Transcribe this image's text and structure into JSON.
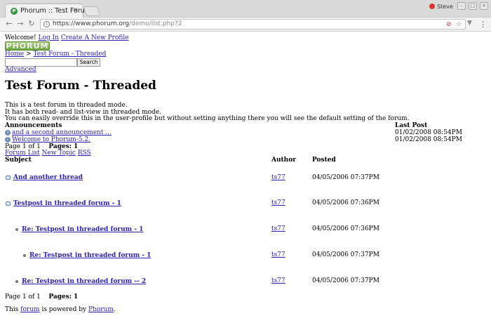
{
  "browser": {
    "tab_title": "Phorum :: Test Foru",
    "tab_close": "×",
    "user_name": "Steve",
    "window_buttons": [
      "–",
      "□",
      "×"
    ],
    "url_domain": "https://www.phorum.org",
    "url_path": "/demo/list.php?2",
    "back": "←",
    "forward": "→",
    "reload": "↻",
    "menu": "⋮",
    "star": "☆"
  },
  "header": {
    "welcome": "Welcome!",
    "login": "Log In",
    "create_profile": "Create A New Profile",
    "logo": "PHORUM",
    "breadcrumb_home": "Home",
    "breadcrumb_sep": ">",
    "breadcrumb_forum": "Test Forum - Threaded"
  },
  "search": {
    "value": "",
    "button": "Search",
    "advanced": "Advanced"
  },
  "forum": {
    "title": "Test Forum - Threaded",
    "description": [
      "This is a test forum in threaded mode.",
      "It has both read- and list-view in threaded mode.",
      "You can easily override this in the user-profile but without setting anything there you will see the default setting of the forum."
    ]
  },
  "announcements": {
    "heading": "Announcements",
    "last_post_heading": "Last Post",
    "items": [
      {
        "title": "and a second announcement ...",
        "last_post": "01/02/2008 08:54PM"
      },
      {
        "title": "Welcome to Phorum-5.2.",
        "last_post": "01/02/2008 08:54PM"
      }
    ]
  },
  "pager": {
    "page_of": "Page 1 of 1",
    "pages_label": "Pages:",
    "pages_current": "1"
  },
  "actions": {
    "forum_list": "Forum List",
    "new_topic": "New Topic",
    "rss": "RSS"
  },
  "table": {
    "headers": {
      "subject": "Subject",
      "author": "Author",
      "posted": "Posted"
    },
    "rows": [
      {
        "subject": "And another thread",
        "author": "ts77",
        "posted": "04/05/2006 07:37PM",
        "level": 0
      },
      {
        "subject": "Testpost in threaded forum - 1",
        "author": "ts77",
        "posted": "04/05/2006 07:36PM",
        "level": 0
      },
      {
        "subject": "Re: Testpost in threaded forum - 1",
        "author": "ts77",
        "posted": "04/05/2006 07:36PM",
        "level": 1
      },
      {
        "subject": "Re: Testpost in threaded forum - 1",
        "author": "ts77",
        "posted": "04/05/2006 07:37PM",
        "level": 2
      },
      {
        "subject": "Re: Testpost in threaded forum -- 2",
        "author": "ts77",
        "posted": "04/05/2006 07:37PM",
        "level": 1
      }
    ]
  },
  "footer": {
    "prefix": "This",
    "forum_link": "forum",
    "middle": "is powered by",
    "phorum_link": "Phorum",
    "suffix": "."
  }
}
